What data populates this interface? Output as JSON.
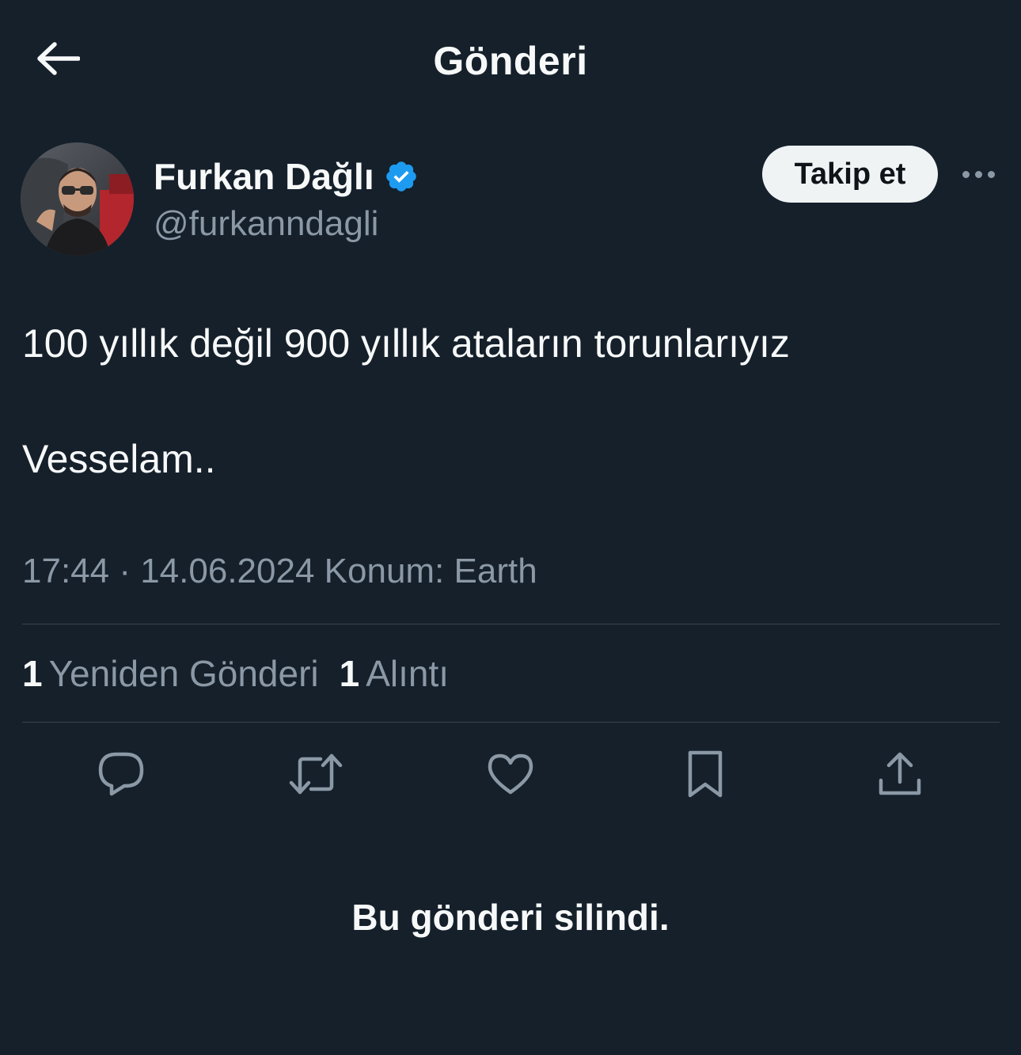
{
  "header": {
    "title": "Gönderi",
    "back_icon": "arrow-left-icon"
  },
  "author": {
    "display_name": "Furkan Dağlı",
    "handle": "@furkanndagli",
    "verified": true,
    "verified_color": "#1d9bf0",
    "follow_label": "Takip et",
    "more_icon": "ellipsis-icon"
  },
  "tweet": {
    "lines": [
      "100 yıllık değil 900 yıllık ataların torunlarıyız",
      "Vesselam.."
    ],
    "meta": "17:44 · 14.06.2024 Konum: Earth"
  },
  "stats": [
    {
      "count": "1",
      "label": "Yeniden Gönderi"
    },
    {
      "count": "1",
      "label": "Alıntı"
    }
  ],
  "actions": [
    {
      "name": "reply",
      "icon": "reply-icon"
    },
    {
      "name": "retweet",
      "icon": "retweet-icon"
    },
    {
      "name": "like",
      "icon": "heart-icon"
    },
    {
      "name": "bookmark",
      "icon": "bookmark-icon"
    },
    {
      "name": "share",
      "icon": "share-icon"
    }
  ],
  "notice": "Bu gönderi silindi.",
  "colors": {
    "background": "#15202b",
    "text": "#f7f9f9",
    "muted": "#8b98a5",
    "divider": "#38444d",
    "follow_bg": "#eff3f4"
  }
}
